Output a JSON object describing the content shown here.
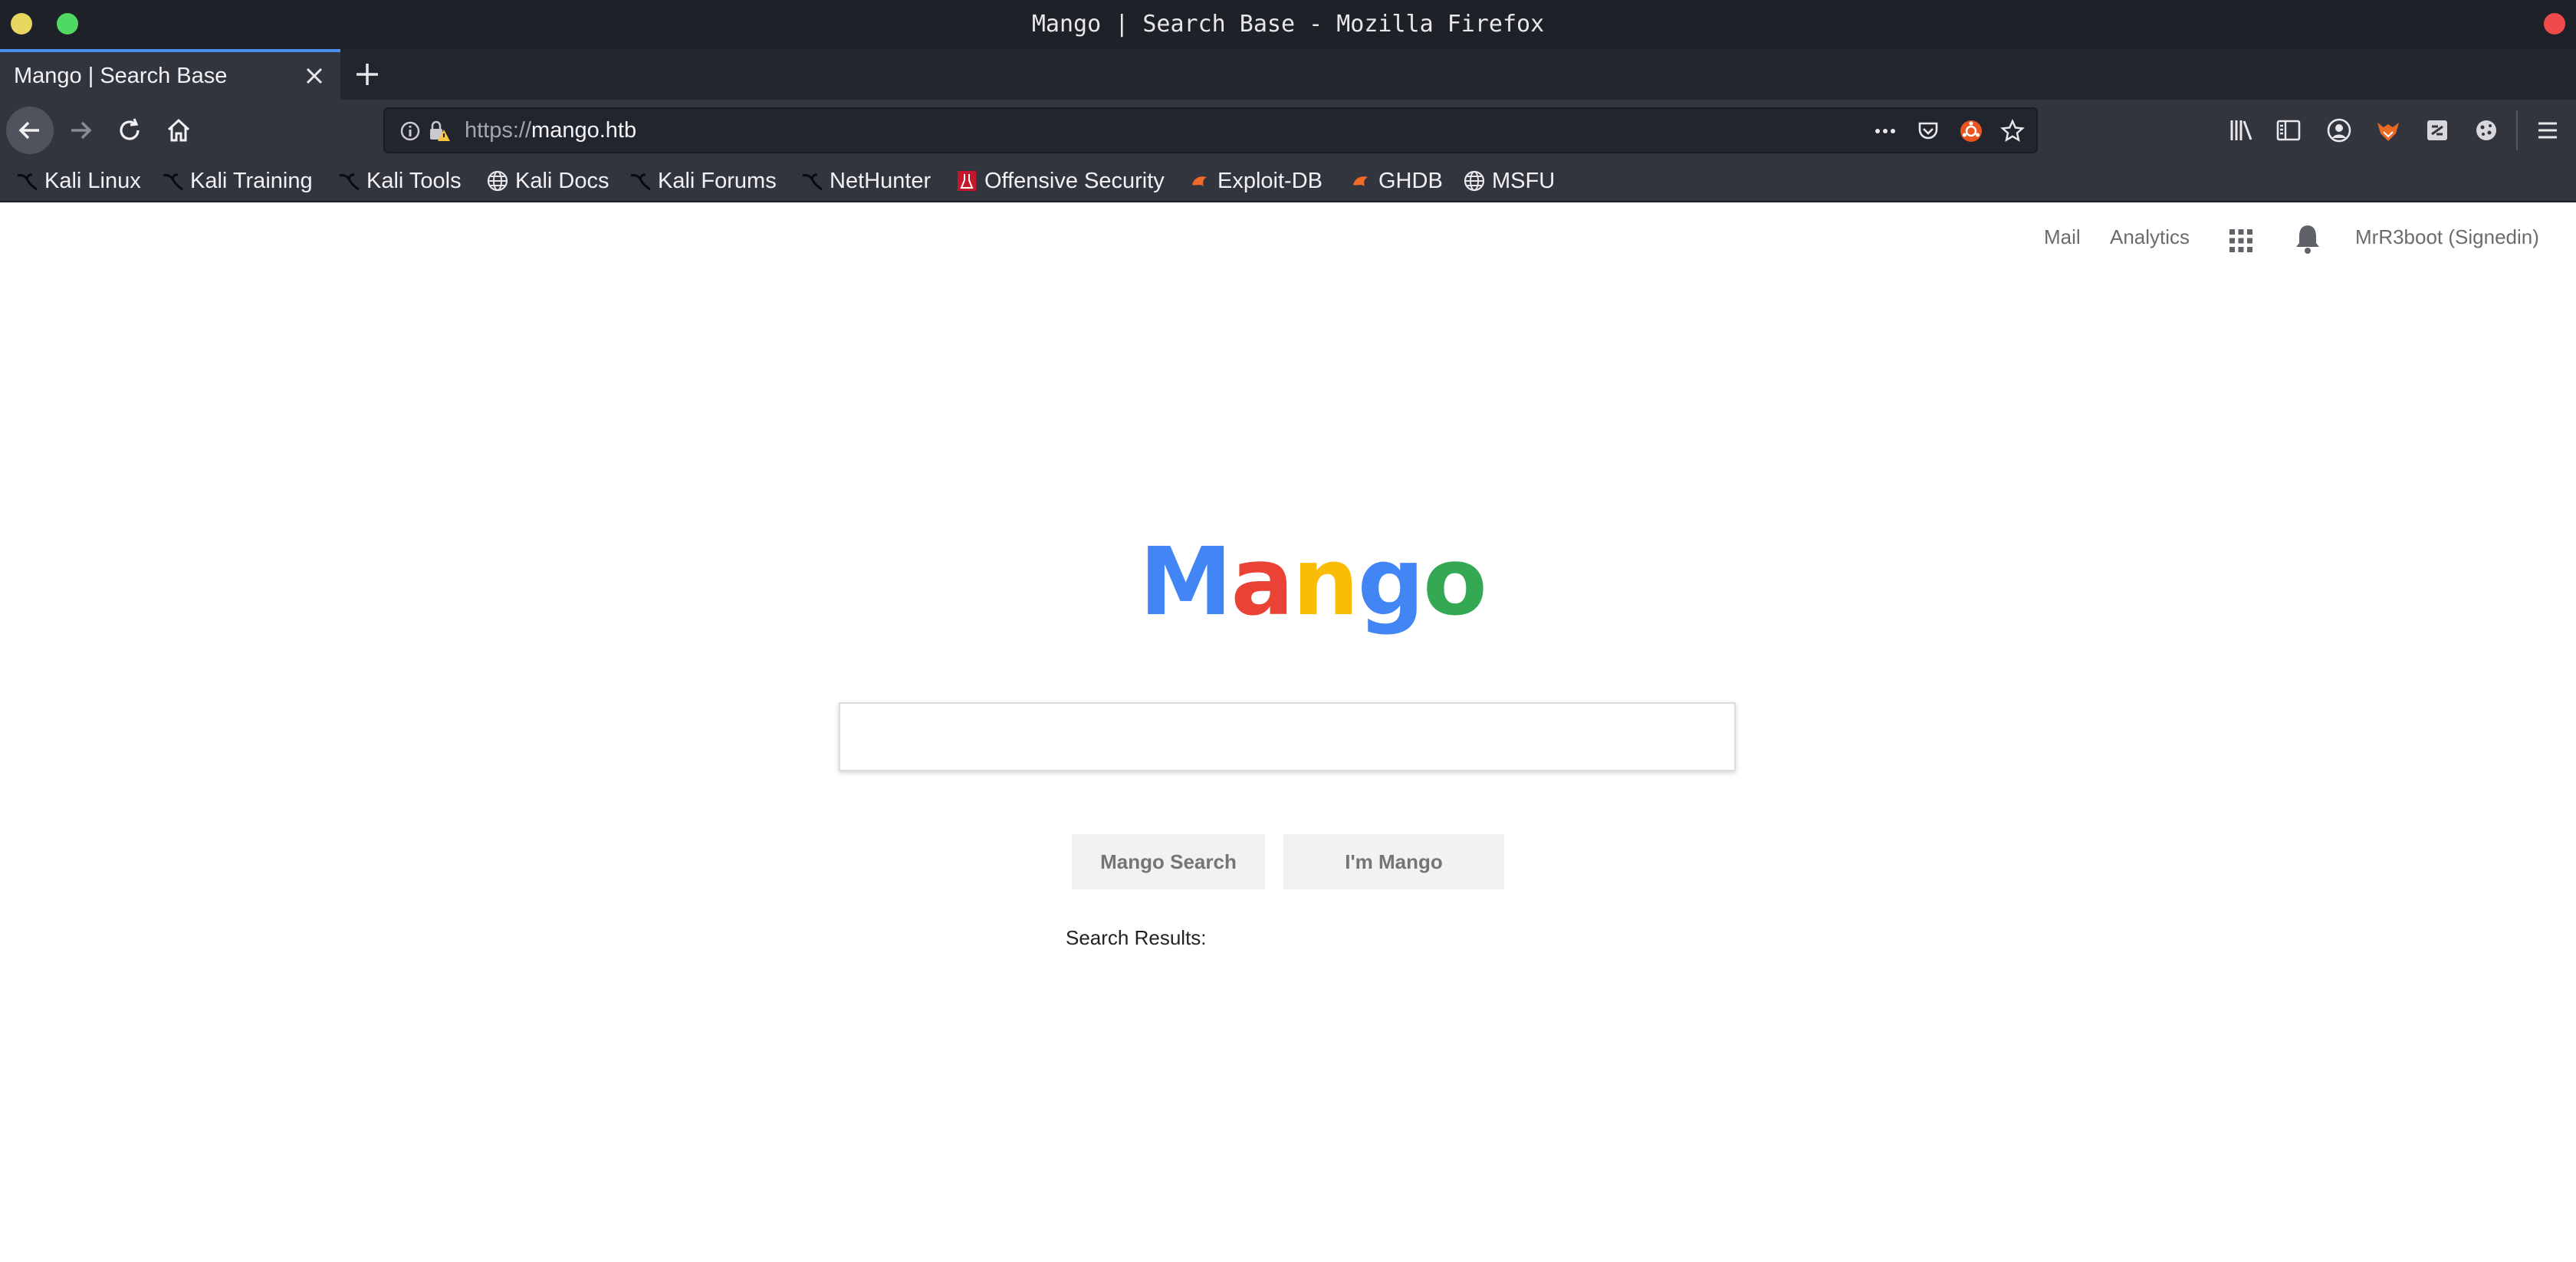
{
  "window": {
    "title": "Mango | Search Base - Mozilla Firefox",
    "controls": {
      "minimize_color": "#e7d660",
      "maximize_color": "#4fd862",
      "close_color": "#f04b4b"
    }
  },
  "tab": {
    "title": "Mango | Search Base"
  },
  "urlbar": {
    "scheme": "https://",
    "host": "mango.htb"
  },
  "bookmarks": [
    {
      "label": "Kali Linux",
      "icon": "kali-dragon-icon"
    },
    {
      "label": "Kali Training",
      "icon": "kali-dragon-icon"
    },
    {
      "label": "Kali Tools",
      "icon": "kali-dragon-icon"
    },
    {
      "label": "Kali Docs",
      "icon": "globe-icon"
    },
    {
      "label": "Kali Forums",
      "icon": "kali-dragon-icon"
    },
    {
      "label": "NetHunter",
      "icon": "kali-dragon-icon"
    },
    {
      "label": "Offensive Security",
      "icon": "offsec-icon"
    },
    {
      "label": "Exploit-DB",
      "icon": "exploitdb-icon"
    },
    {
      "label": "GHDB",
      "icon": "exploitdb-icon"
    },
    {
      "label": "MSFU",
      "icon": "globe-icon"
    }
  ],
  "page": {
    "top_links": {
      "mail": "Mail",
      "analytics": "Analytics",
      "user": "MrR3boot (Signedin)"
    },
    "logo": {
      "letters": [
        "M",
        "a",
        "n",
        "g",
        "o"
      ],
      "colors": [
        "#4285f4",
        "#ea4335",
        "#fbbc05",
        "#4285f4",
        "#34a853"
      ]
    },
    "search": {
      "value": "",
      "placeholder": ""
    },
    "buttons": {
      "search": "Mango Search",
      "lucky": "I'm Mango"
    },
    "results_label": "Search Results:"
  },
  "colors": {
    "accent": "#4d8ff0",
    "chrome_dark": "#1f2129",
    "toolbar": "#32343e"
  }
}
